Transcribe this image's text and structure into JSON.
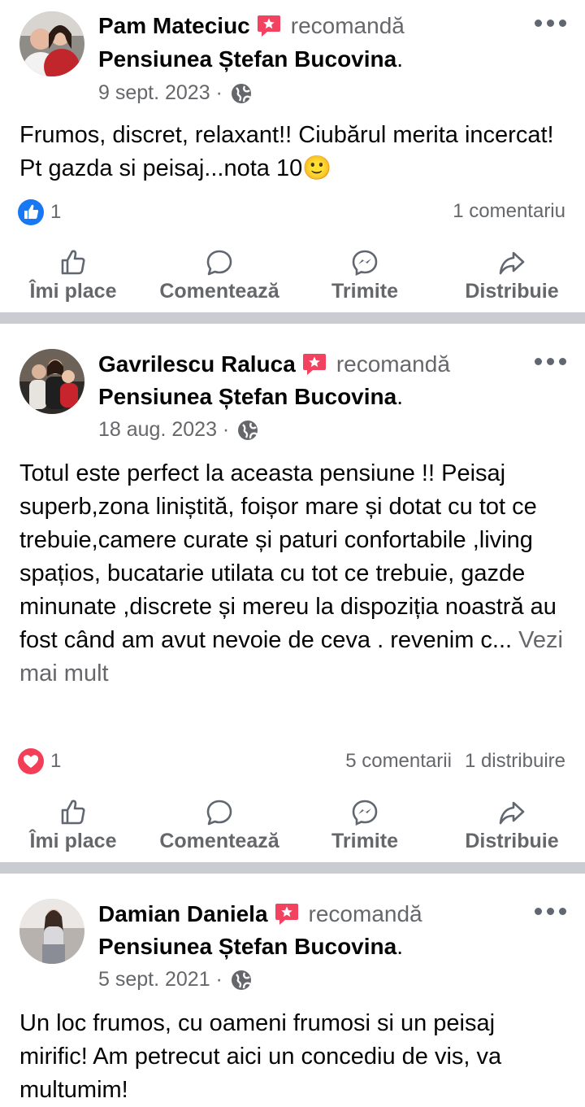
{
  "posts": [
    {
      "author": "Pam Mateciuc",
      "action": "recomandă",
      "page": "Pensiunea Ștefan Bucovina",
      "date": "9 sept. 2023 ·",
      "text": "Frumos, discret, relaxant!! Ciubărul merita incercat! Pt gazda si peisaj...nota 10🙂",
      "see_more": "",
      "reaction_type": "like",
      "reaction_count": "1",
      "comments": "1 comentariu",
      "shares": ""
    },
    {
      "author": "Gavrilescu Raluca",
      "action": "recomandă",
      "page": "Pensiunea Ștefan Bucovina",
      "date": "18 aug. 2023 ·",
      "text": "Totul este perfect la aceasta pensiune !! Peisaj superb,zona liniștită, foișor mare și dotat cu tot ce trebuie,camere curate și paturi confortabile ,living spațios, bucatarie utilata cu tot ce trebuie, gazde minunate ,discrete și mereu la dispoziția noastră au fost când am avut nevoie de ceva . revenim c...",
      "see_more": "Vezi mai mult",
      "reaction_type": "love",
      "reaction_count": "1",
      "comments": "5 comentarii",
      "shares": "1 distribuire"
    },
    {
      "author": "Damian Daniela",
      "action": "recomandă",
      "page": "Pensiunea Ștefan Bucovina",
      "date": "5 sept. 2021 ·",
      "text": "Un loc frumos, cu oameni frumosi si un peisaj mirific! Am petrecut aici un concediu de vis, va multumim!",
      "see_more": ""
    }
  ],
  "actions": {
    "like": "Îmi place",
    "comment": "Comentează",
    "send": "Trimite",
    "share": "Distribuie"
  },
  "colors": {
    "like_blue": "#1877f2",
    "love_red": "#f33e58",
    "recommend_red": "#f3425f",
    "muted_text": "#65676b",
    "separator": "#c9ccd1"
  },
  "icons": [
    "recommend-icon",
    "globe-icon",
    "more-icon",
    "like-reaction-icon",
    "love-reaction-icon",
    "thumbs-up-icon",
    "comment-icon",
    "messenger-icon",
    "share-icon"
  ]
}
